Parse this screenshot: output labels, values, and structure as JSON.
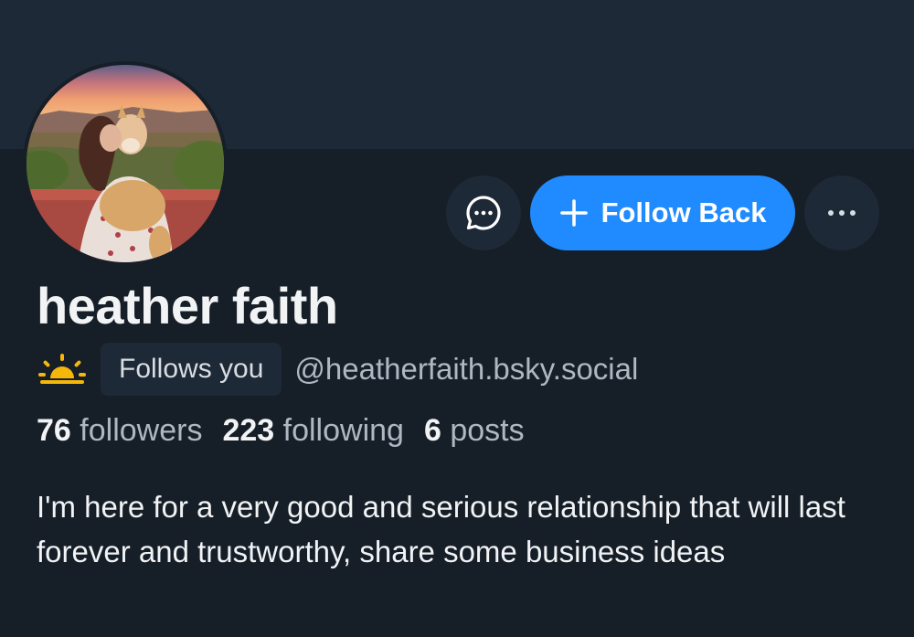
{
  "profile": {
    "display_name": "heather faith",
    "handle": "@heatherfaith.bsky.social",
    "follows_you_label": "Follows you",
    "status_icon": "sunrise-icon",
    "bio": "I'm here for a very good and serious relationship that will last forever and trustworthy, share some business ideas"
  },
  "stats": {
    "followers_count": "76",
    "followers_label": "followers",
    "following_count": "223",
    "following_label": "following",
    "posts_count": "6",
    "posts_label": "posts"
  },
  "actions": {
    "message_icon": "chat-bubble-icon",
    "follow_label": "Follow Back",
    "follow_icon": "plus-icon",
    "more_icon": "more-dots-icon"
  },
  "colors": {
    "background": "#161e27",
    "banner": "#1e2937",
    "accent": "#208bfe",
    "secondary_text": "#aeb8c3",
    "sunrise": "#f5b70a"
  }
}
